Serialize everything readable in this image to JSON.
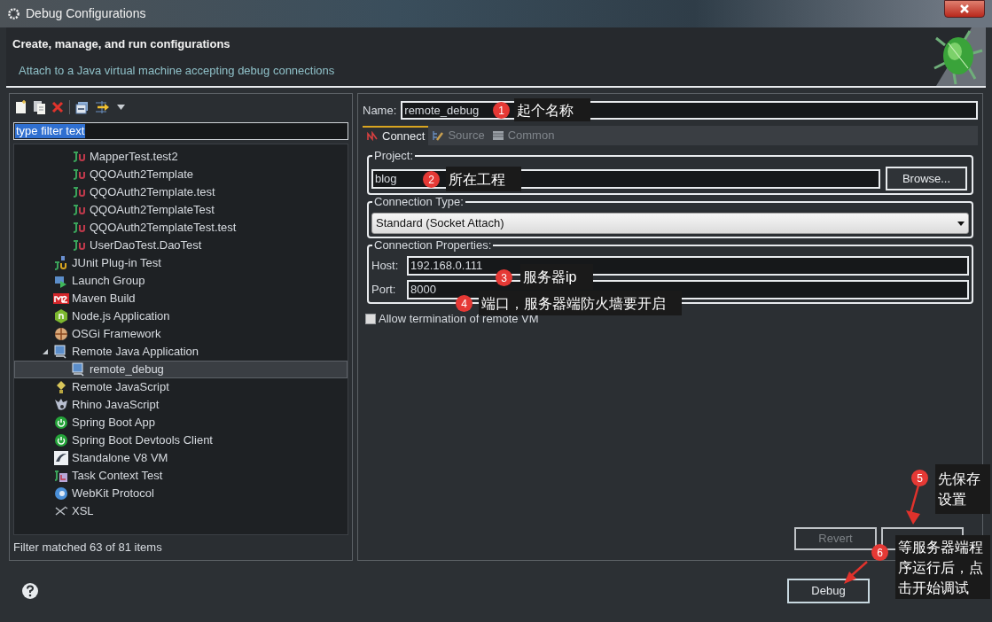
{
  "window": {
    "title": "Debug Configurations"
  },
  "header": {
    "heading": "Create, manage, and run configurations",
    "description": "Attach to a Java virtual machine accepting debug connections"
  },
  "filter": {
    "value": "type filter text"
  },
  "tree": {
    "continued": [
      {
        "label": "MapperTest.test2",
        "kind": "junit",
        "selected": false
      },
      {
        "label": "QQOAuth2Template",
        "kind": "junit",
        "selected": false
      },
      {
        "label": "QQOAuth2Template.test",
        "kind": "junit",
        "selected": false
      },
      {
        "label": "QQOAuth2TemplateTest",
        "kind": "junit",
        "selected": false
      },
      {
        "label": "QQOAuth2TemplateTest.test",
        "kind": "junit",
        "selected": false
      },
      {
        "label": "UserDaoTest.DaoTest",
        "kind": "junit",
        "selected": false
      }
    ],
    "items": [
      {
        "label": "JUnit Plug-in Test",
        "kind": "plugin",
        "selected": false
      },
      {
        "label": "Launch Group",
        "kind": "group",
        "selected": false
      },
      {
        "label": "Maven Build",
        "kind": "maven",
        "selected": false
      },
      {
        "label": "Node.js Application",
        "kind": "node",
        "selected": false
      },
      {
        "label": "OSGi Framework",
        "kind": "osgi",
        "selected": false
      },
      {
        "label": "Remote Java Application",
        "kind": "remote",
        "selected": false,
        "expanded": true,
        "children": [
          {
            "label": "remote_debug",
            "kind": "remote",
            "selected": true
          }
        ]
      },
      {
        "label": "Remote JavaScript",
        "kind": "remotejs",
        "selected": false
      },
      {
        "label": "Rhino JavaScript",
        "kind": "rhino",
        "selected": false
      },
      {
        "label": "Spring Boot App",
        "kind": "spring",
        "selected": false
      },
      {
        "label": "Spring Boot Devtools Client",
        "kind": "spring",
        "selected": false
      },
      {
        "label": "Standalone V8 VM",
        "kind": "v8",
        "selected": false
      },
      {
        "label": "Task Context Test",
        "kind": "task",
        "selected": false
      },
      {
        "label": "WebKit Protocol",
        "kind": "webkit",
        "selected": false
      },
      {
        "label": "XSL",
        "kind": "xsl",
        "selected": false
      }
    ]
  },
  "status": "Filter matched 63 of 81 items",
  "name": {
    "label": "Name:",
    "value": "remote_debug"
  },
  "tabs": [
    {
      "label": "Connect",
      "selected": true
    },
    {
      "label": "Source",
      "selected": false
    },
    {
      "label": "Common",
      "selected": false
    }
  ],
  "project": {
    "label": "Project:",
    "value": "blog",
    "button": "Browse..."
  },
  "connection_type": {
    "label": "Connection Type:",
    "value": "Standard (Socket Attach)"
  },
  "connection_properties": {
    "label": "Connection Properties:",
    "host_label": "Host:",
    "host": "192.168.0.111",
    "port_label": "Port:",
    "port": "8000"
  },
  "allow_termination": {
    "label": "Allow termination of remote VM",
    "checked": false
  },
  "revert": {
    "label": "Revert",
    "disabled": true
  },
  "debug_button": "Debug",
  "annotations": [
    {
      "number": "1",
      "text": "起个名称"
    },
    {
      "number": "2",
      "text": "所在工程"
    },
    {
      "number": "3",
      "text": "服务器ip"
    },
    {
      "number": "4",
      "text": "端口，服务器端防火墙要开启"
    },
    {
      "number": "5",
      "text": "先保存设置"
    },
    {
      "number": "6",
      "text": "等服务器端程序运行后，点击开始调试"
    }
  ]
}
